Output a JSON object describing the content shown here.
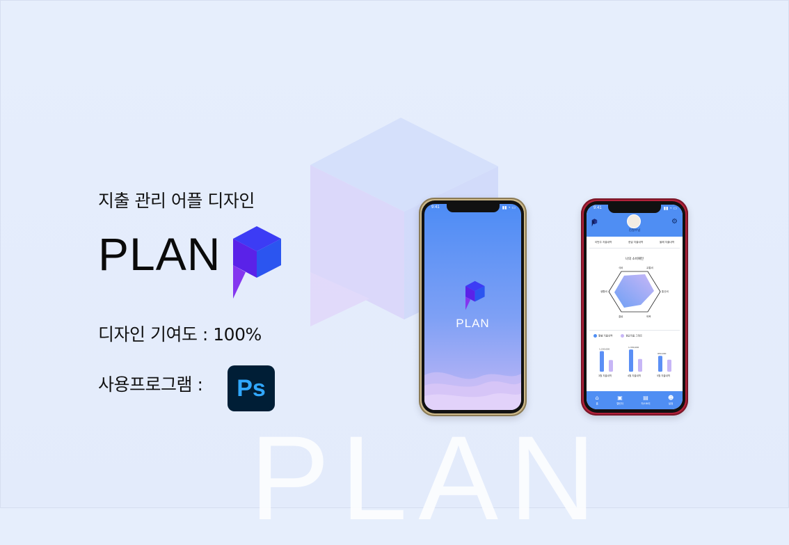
{
  "intro": {
    "subtitle": "지출 관리 어플 디자인",
    "brand": "PLAN",
    "contribution": "디자인 기여도 : 100%",
    "tools_label": "사용프로그램 :",
    "tool_icon": "photoshop-icon",
    "tool_icon_text": "Ps"
  },
  "background": {
    "watermark_word": "PLAN"
  },
  "colors": {
    "brand_blue": "#3b3bf0",
    "brand_purple": "#7a36f0",
    "app_blue": "#4f8ef3",
    "ps_bg": "#001e36",
    "ps_text": "#31a8ff"
  },
  "phone_splash": {
    "status_time": "9:41",
    "word": "PLAN"
  },
  "phone_main": {
    "status_time": "9:41",
    "user_name": "김철수님",
    "tabs": [
      "이번주 지출내역",
      "한달 지출내역",
      "올해 지출내역"
    ],
    "radar": {
      "title": "나의 소비패턴",
      "axes": [
        "식비",
        "교통비",
        "통신비",
        "의복",
        "결료",
        "생활비"
      ]
    },
    "legend": [
      "월별 지출내역",
      "평균지출 그래프"
    ],
    "bars": {
      "months": [
        "3월 지출내역",
        "4월 지출내역",
        "5월 지출내역"
      ],
      "value_labels": [
        "1,230,000",
        "1,330,000",
        "950,000"
      ],
      "values": [
        1230000,
        1330000,
        950000
      ],
      "averages": [
        700000,
        760000,
        720000
      ]
    },
    "nav": [
      {
        "label": "홈",
        "icon": "home-icon"
      },
      {
        "label": "캘린더",
        "icon": "calendar-icon"
      },
      {
        "label": "히스토리",
        "icon": "clipboard-icon"
      },
      {
        "label": "설정",
        "icon": "user-settings-icon"
      }
    ]
  }
}
